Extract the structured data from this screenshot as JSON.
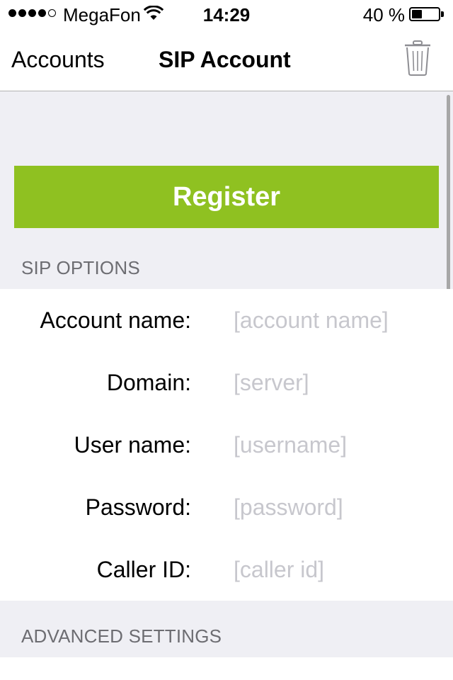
{
  "status_bar": {
    "signal_filled": 4,
    "signal_total": 5,
    "carrier": "MegaFon",
    "time": "14:29",
    "battery_percent_text": "40 %",
    "battery_level": 0.4
  },
  "nav": {
    "back_label": "Accounts",
    "title": "SIP Account",
    "delete_icon": "trash-icon"
  },
  "register_button": {
    "label": "Register",
    "color": "#8fc121"
  },
  "sip_options": {
    "header": "SIP OPTIONS",
    "rows": [
      {
        "label": "Account name:",
        "value": "",
        "placeholder": "[account name]"
      },
      {
        "label": "Domain:",
        "value": "",
        "placeholder": "[server]"
      },
      {
        "label": "User name:",
        "value": "",
        "placeholder": "[username]"
      },
      {
        "label": "Password:",
        "value": "",
        "placeholder": "[password]"
      },
      {
        "label": "Caller ID:",
        "value": "",
        "placeholder": "[caller id]"
      }
    ]
  },
  "advanced": {
    "header": "ADVANCED SETTINGS"
  }
}
